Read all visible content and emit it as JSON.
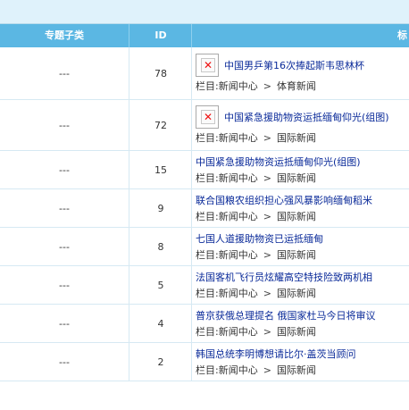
{
  "header": {
    "col_subcategory": "专题子类",
    "col_id": "ID",
    "col_title": "标"
  },
  "rows": [
    {
      "sub": "---",
      "id": "78",
      "title": "中国男乒第16次捧起斯韦思林杯",
      "has_thumb": true,
      "meta_prefix": "栏目:",
      "cat1": "新闻中心",
      "sep": ">",
      "cat2": "体育新闻"
    },
    {
      "sub": "---",
      "id": "72",
      "title": "中国紧急援助物资运抵缅甸仰光(组图)",
      "has_thumb": true,
      "meta_prefix": "栏目:",
      "cat1": "新闻中心",
      "sep": ">",
      "cat2": "国际新闻"
    },
    {
      "sub": "---",
      "id": "15",
      "title": "中国紧急援助物资运抵缅甸仰光(组图)",
      "has_thumb": false,
      "meta_prefix": "栏目:",
      "cat1": "新闻中心",
      "sep": ">",
      "cat2": "国际新闻"
    },
    {
      "sub": "---",
      "id": "9",
      "title": "联合国粮农组织担心强风暴影响缅甸稻米",
      "has_thumb": false,
      "meta_prefix": "栏目:",
      "cat1": "新闻中心",
      "sep": ">",
      "cat2": "国际新闻"
    },
    {
      "sub": "---",
      "id": "8",
      "title": "七国人道援助物资已运抵缅甸",
      "has_thumb": false,
      "meta_prefix": "栏目:",
      "cat1": "新闻中心",
      "sep": ">",
      "cat2": "国际新闻"
    },
    {
      "sub": "---",
      "id": "5",
      "title": "法国客机飞行员炫耀高空特技险致两机相",
      "has_thumb": false,
      "meta_prefix": "栏目:",
      "cat1": "新闻中心",
      "sep": ">",
      "cat2": "国际新闻"
    },
    {
      "sub": "---",
      "id": "4",
      "title": "普京获俄总理提名 俄国家杜马今日将审议",
      "has_thumb": false,
      "meta_prefix": "栏目:",
      "cat1": "新闻中心",
      "sep": ">",
      "cat2": "国际新闻"
    },
    {
      "sub": "---",
      "id": "2",
      "title": "韩国总统李明博想请比尔·盖茨当顾问",
      "has_thumb": false,
      "meta_prefix": "栏目:",
      "cat1": "新闻中心",
      "sep": ">",
      "cat2": "国际新闻"
    }
  ]
}
